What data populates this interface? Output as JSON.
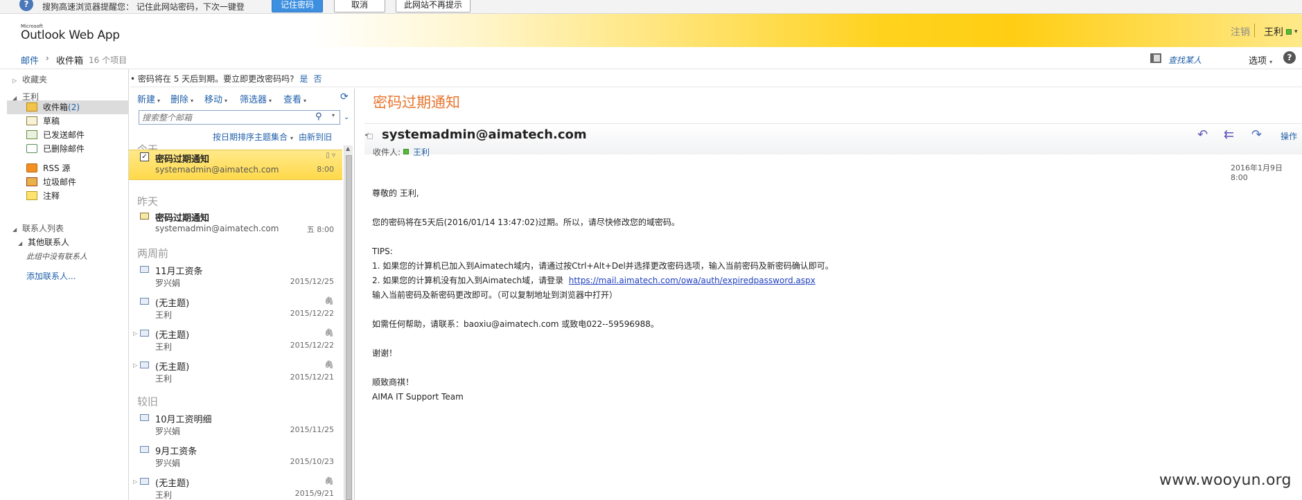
{
  "notify": {
    "message": "搜狗高速浏览器提醒您： 记住此网站密码，下次一键登录！",
    "remember_label": "记住密码",
    "cancel_label": "取消",
    "never_label": "此网站不再提示"
  },
  "header": {
    "brand_small": "Microsoft",
    "app_name": "Outlook Web App",
    "signout_label": "注销",
    "user_name": "王利"
  },
  "breadcrumb": {
    "mail": "邮件",
    "folder": "收件箱",
    "count": "16 个项目",
    "find_people": "查找某人",
    "options": "选项",
    "help": "?"
  },
  "nav": {
    "favorites": "收藏夹",
    "mailbox_owner": "王利",
    "folders": [
      {
        "label": "收件箱",
        "count": "(2)",
        "icon": "inbox-icon"
      },
      {
        "label": "草稿",
        "icon": "drafts-icon"
      },
      {
        "label": "已发送邮件",
        "icon": "sent-icon"
      },
      {
        "label": "已删除邮件",
        "icon": "deleted-icon"
      },
      {
        "label": "RSS 源",
        "icon": "rss-icon"
      },
      {
        "label": "垃圾邮件",
        "icon": "junk-icon"
      },
      {
        "label": "注释",
        "icon": "notes-icon"
      }
    ],
    "contact_lists": "联系人列表",
    "other_contacts": "其他联系人",
    "no_contacts": "此组中没有联系人",
    "add_contact": "添加联系人..."
  },
  "notice": {
    "text": "• 密码将在 5 天后到期。要立即更改密码吗?",
    "yes": "是",
    "no": "否"
  },
  "toolbar": {
    "new": "新建",
    "delete": "删除",
    "move": "移动",
    "filter": "筛选器",
    "view": "查看"
  },
  "search": {
    "placeholder": "搜索整个邮箱"
  },
  "sort": {
    "order": "按日期排序主题集合",
    "direction": "由新到旧"
  },
  "groups": {
    "today": "今天",
    "yesterday": "昨天",
    "two_weeks": "两周前",
    "older": "较旧"
  },
  "messages": [
    {
      "subject": "密码过期通知",
      "from": "systemadmin@aimatech.com",
      "date": "8:00"
    },
    {
      "subject": "密码过期通知",
      "from": "systemadmin@aimatech.com",
      "date": "五 8:00"
    },
    {
      "subject": "11月工资条",
      "from": "罗兴娟",
      "date": "2015/12/25"
    },
    {
      "subject": "(无主题)",
      "from": "王利",
      "date": "2015/12/22"
    },
    {
      "subject": "(无主题)",
      "from": "王利",
      "date": "2015/12/22"
    },
    {
      "subject": "(无主题)",
      "from": "王利",
      "date": "2015/12/21"
    },
    {
      "subject": "10月工资明细",
      "from": "罗兴娟",
      "date": "2015/11/25"
    },
    {
      "subject": "9月工资条",
      "from": "罗兴娟",
      "date": "2015/10/23"
    },
    {
      "subject": "(无主题)",
      "from": "王利",
      "date": "2015/9/21"
    }
  ],
  "reader": {
    "title": "密码过期通知",
    "sender": "systemadmin@aimatech.com",
    "to_label": "收件人:",
    "to": "王利",
    "actions_label": "操作",
    "date": "2016年1月9日 8:00",
    "body": {
      "greeting": "尊敬的 王利,",
      "line1": "您的密码将在5天后(2016/01/14 13:47:02)过期。所以，请尽快修改您的域密码。",
      "tips": "TIPS:",
      "tip1": "1. 如果您的计算机已加入到Aimatech域内，请通过按Ctrl+Alt+Del并选择更改密码选项，输入当前密码及新密码确认即可。",
      "tip2_prefix": "2. 如果您的计算机没有加入到Aimatech域，请登录",
      "tip2_link": "https://mail.aimatech.com/owa/auth/expiredpassword.aspx",
      "tip2_cont": "输入当前密码及新密码更改即可。（可以复制地址到浏览器中打开）",
      "help": "如需任何帮助，请联系：baoxiu@aimatech.com 或致电022--59596988。",
      "thanks": "谢谢！",
      "regards": "顺致商祺！",
      "signature": "AIMA IT Support Team"
    }
  },
  "watermark": "www.wooyun.org"
}
